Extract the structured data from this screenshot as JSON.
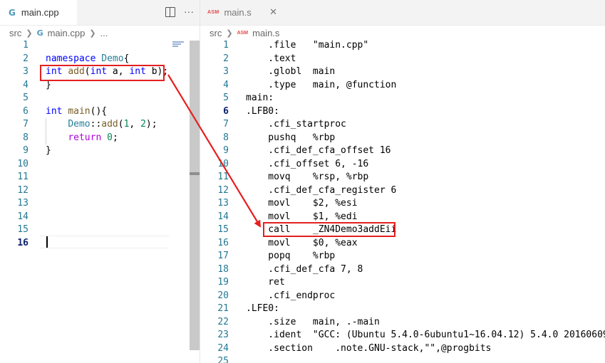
{
  "left_editor": {
    "tab": {
      "icon": "cpp-icon",
      "label": "main.cpp"
    },
    "breadcrumb": [
      "src",
      "main.cpp",
      "..."
    ],
    "lines": [
      {
        "n": "1",
        "tokens": []
      },
      {
        "n": "2",
        "tokens": [
          {
            "t": "namespace",
            "c": "kw"
          },
          {
            "t": " "
          },
          {
            "t": "Demo",
            "c": "ns"
          },
          {
            "t": "{"
          }
        ]
      },
      {
        "n": "3",
        "tokens": [
          {
            "t": "int",
            "c": "kw"
          },
          {
            "t": " "
          },
          {
            "t": "add",
            "c": "fn"
          },
          {
            "t": "("
          },
          {
            "t": "int",
            "c": "kw"
          },
          {
            "t": " a, "
          },
          {
            "t": "int",
            "c": "kw"
          },
          {
            "t": " b);"
          }
        ]
      },
      {
        "n": "4",
        "tokens": [
          {
            "t": "}"
          }
        ]
      },
      {
        "n": "5",
        "tokens": []
      },
      {
        "n": "6",
        "tokens": [
          {
            "t": "int",
            "c": "kw"
          },
          {
            "t": " "
          },
          {
            "t": "main",
            "c": "fn"
          },
          {
            "t": "(){"
          }
        ]
      },
      {
        "n": "7",
        "tokens": [
          {
            "t": "    "
          },
          {
            "t": "Demo",
            "c": "ns"
          },
          {
            "t": "::"
          },
          {
            "t": "add",
            "c": "fn"
          },
          {
            "t": "("
          },
          {
            "t": "1",
            "c": "num"
          },
          {
            "t": ", "
          },
          {
            "t": "2",
            "c": "num"
          },
          {
            "t": ");"
          }
        ]
      },
      {
        "n": "8",
        "tokens": [
          {
            "t": "    "
          },
          {
            "t": "return",
            "c": "ret"
          },
          {
            "t": " "
          },
          {
            "t": "0",
            "c": "num"
          },
          {
            "t": ";"
          }
        ]
      },
      {
        "n": "9",
        "tokens": [
          {
            "t": "}"
          }
        ]
      },
      {
        "n": "10",
        "tokens": []
      },
      {
        "n": "11",
        "tokens": []
      },
      {
        "n": "12",
        "tokens": []
      },
      {
        "n": "13",
        "tokens": []
      },
      {
        "n": "14",
        "tokens": []
      },
      {
        "n": "15",
        "tokens": []
      },
      {
        "n": "16",
        "tokens": [],
        "active": true
      }
    ]
  },
  "right_editor": {
    "tab": {
      "icon": "asm-icon",
      "icon_text": "ASM",
      "label": "main.s"
    },
    "breadcrumb": [
      "src",
      "ASM",
      "main.s"
    ],
    "lines": [
      {
        "n": "1",
        "text": "    .file   \"main.cpp\""
      },
      {
        "n": "2",
        "text": "    .text"
      },
      {
        "n": "3",
        "text": "    .globl  main"
      },
      {
        "n": "4",
        "text": "    .type   main, @function"
      },
      {
        "n": "5",
        "text": "main:"
      },
      {
        "n": "6",
        "text": ".LFB0:",
        "active": true
      },
      {
        "n": "7",
        "text": "    .cfi_startproc"
      },
      {
        "n": "8",
        "text": "    pushq   %rbp"
      },
      {
        "n": "9",
        "text": "    .cfi_def_cfa_offset 16"
      },
      {
        "n": "10",
        "text": "    .cfi_offset 6, -16"
      },
      {
        "n": "11",
        "text": "    movq    %rsp, %rbp"
      },
      {
        "n": "12",
        "text": "    .cfi_def_cfa_register 6"
      },
      {
        "n": "13",
        "text": "    movl    $2, %esi"
      },
      {
        "n": "14",
        "text": "    movl    $1, %edi"
      },
      {
        "n": "15",
        "text": "    call    _ZN4Demo3addEii"
      },
      {
        "n": "16",
        "text": "    movl    $0, %eax"
      },
      {
        "n": "17",
        "text": "    popq    %rbp"
      },
      {
        "n": "18",
        "text": "    .cfi_def_cfa 7, 8"
      },
      {
        "n": "19",
        "text": "    ret"
      },
      {
        "n": "20",
        "text": "    .cfi_endproc"
      },
      {
        "n": "21",
        "text": ".LFE0:"
      },
      {
        "n": "22",
        "text": "    .size   main, .-main"
      },
      {
        "n": "23",
        "text": "    .ident  \"GCC: (Ubuntu 5.4.0-6ubuntu1~16.04.12) 5.4.0 20160609\""
      },
      {
        "n": "24",
        "text": "    .section    .note.GNU-stack,\"\",@progbits"
      },
      {
        "n": "25",
        "text": ""
      }
    ]
  },
  "toolbar": {
    "split_icon": "split-editor-icon",
    "more_label": "···",
    "close_label": "✕"
  },
  "annotation": {
    "color": "#e51f1f"
  }
}
